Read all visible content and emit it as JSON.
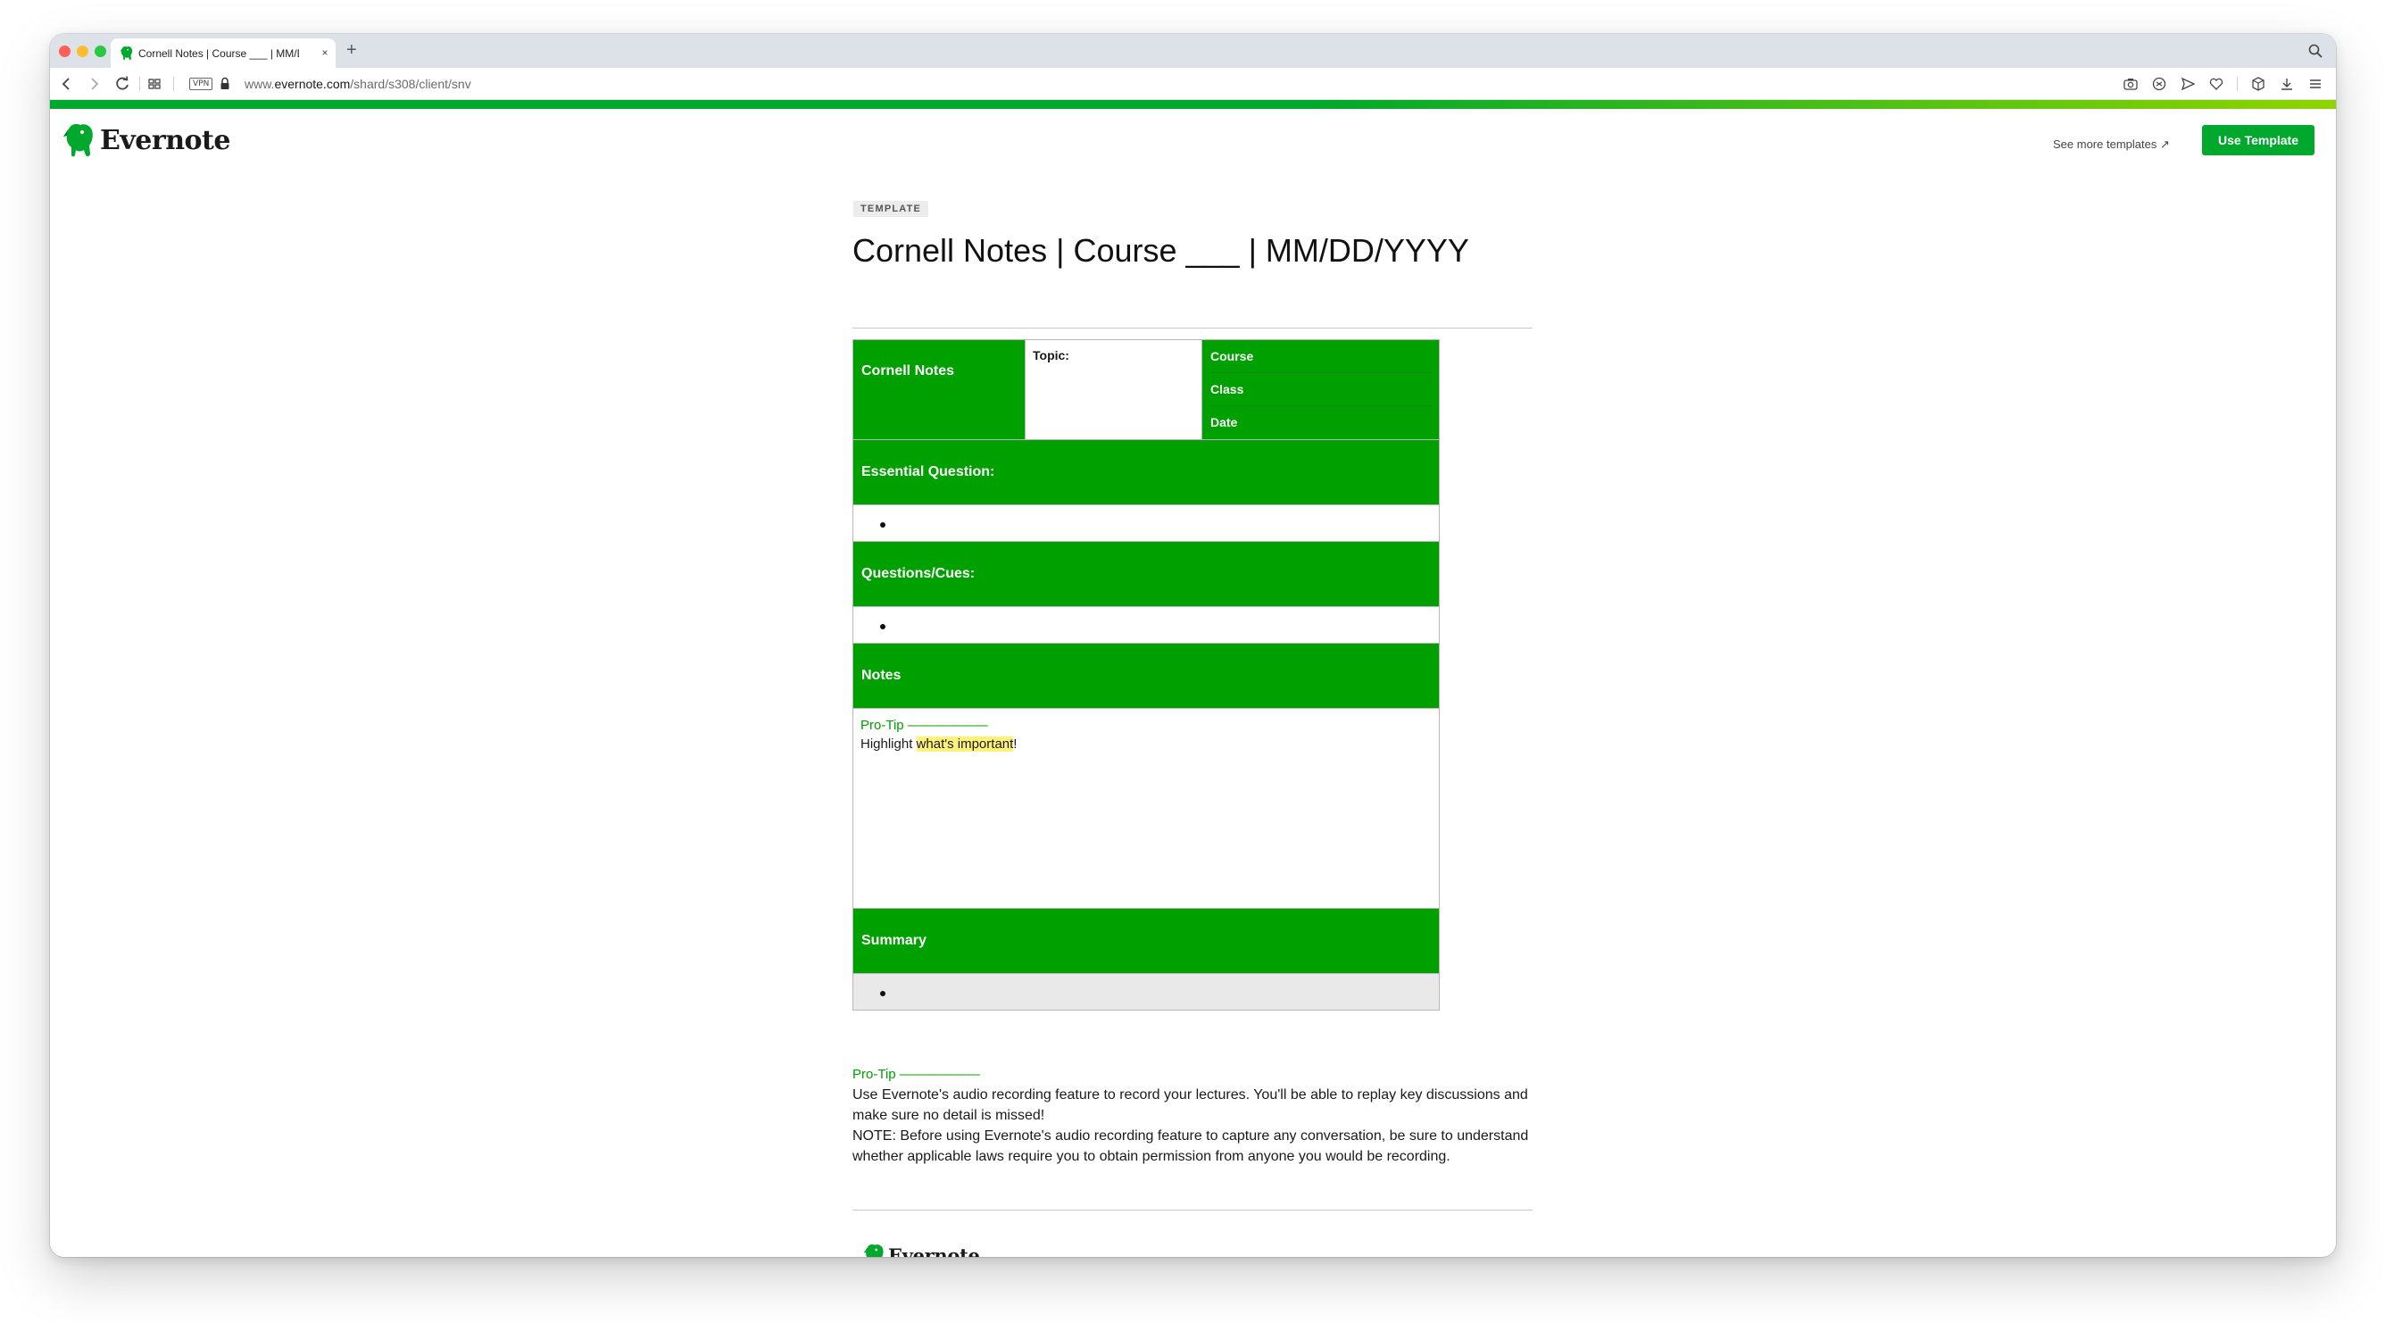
{
  "browser": {
    "tab_title": "Cornell Notes | Course ___ | MM/DD/YYYY",
    "tab_close": "×",
    "new_tab": "+",
    "vpn_label": "VPN",
    "url_prefix": "www.",
    "url_domain": "evernote.com",
    "url_path": "/shard/s308/client/snv"
  },
  "header": {
    "logo_text": "Evernote",
    "see_more_label": "See more templates ↗",
    "use_template_label": "Use Template"
  },
  "note": {
    "badge": "TEMPLATE",
    "title": "Cornell Notes | Course ___ | MM/DD/YYYY",
    "table": {
      "heading": "Cornell Notes",
      "topic_label": "Topic:",
      "meta_fields": [
        "Course",
        "Class",
        "Date"
      ],
      "essential_question": "Essential Question:",
      "questions_cues": "Questions/Cues:",
      "notes": "Notes",
      "notes_protip": "Pro-Tip",
      "notes_protip_dash": "——————",
      "notes_text_before": "Highlight ",
      "notes_text_highlight": "what's important",
      "notes_text_after": "!",
      "summary": "Summary"
    },
    "protip_label": "Pro-Tip",
    "protip_dash": "——————",
    "protip_body": "Use Evernote's audio recording feature to record your lectures. You'll be able to replay key discussions and make sure no detail is missed!",
    "protip_note": "NOTE: Before using Evernote's audio recording feature to capture any conversation, be sure to understand whether applicable laws require you to obtain permission from anyone you would be recording.",
    "footer_logo_text": "Evernote"
  },
  "colors": {
    "evernote_green": "#00a82d",
    "table_green": "#00a000",
    "highlight": "#fff27a"
  },
  "icons": [
    "evernote-elephant-icon",
    "back-icon",
    "forward-icon",
    "reload-icon",
    "tab-grid-icon",
    "lock-icon",
    "camera-icon",
    "shield-icon",
    "send-icon",
    "heart-icon",
    "box-icon",
    "download-icon",
    "menu-icon",
    "search-icon"
  ]
}
